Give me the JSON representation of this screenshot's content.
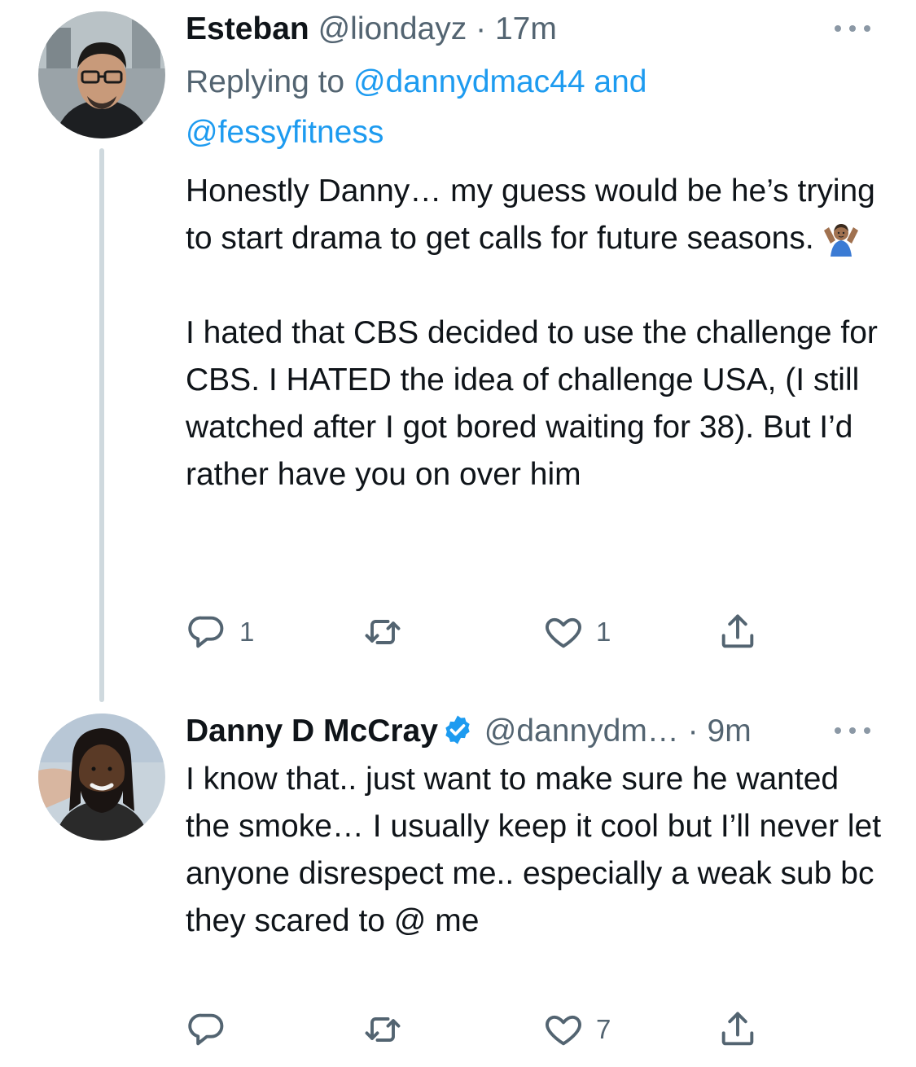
{
  "tweets": [
    {
      "author": {
        "name": "Esteban",
        "handle": "@liondayz",
        "time": "17m",
        "avatar": "avatar-man-glasses",
        "verified": false
      },
      "replying": {
        "prefix": "Replying to",
        "mention1": "@dannydmac44",
        "joiner": "and",
        "mention2": "@fessyfitness"
      },
      "text_part1": "Honestly Danny… my guess would be he’s trying to start drama to get calls for future seasons.",
      "emoji": "person-shrugging-emoji",
      "text_part2": "\n\nI hated that CBS decided to use the challenge for CBS. I HATED the idea of challenge USA, (I still watched after I got bored waiting for 38). But I’d rather have you on over him",
      "actions": {
        "reply_count": "1",
        "retweet_count": "",
        "like_count": "1"
      }
    },
    {
      "author": {
        "name": "Danny D McCray",
        "handle": "@dannydm…",
        "time": "9m",
        "avatar": "avatar-man-beard",
        "verified": true
      },
      "text": "I know that.. just want to make sure he wanted the smoke… I usually keep it cool but I’ll never let anyone disrespect me.. especially a weak sub bc they scared to @ me",
      "actions": {
        "reply_count": "",
        "retweet_count": "",
        "like_count": "7"
      }
    }
  ],
  "separator": "·",
  "icons": {
    "reply": "reply-icon",
    "retweet": "retweet-icon",
    "like": "heart-icon",
    "share": "share-icon",
    "more": "more-icon",
    "verified": "verified-badge-icon"
  },
  "colors": {
    "text": "#0f1419",
    "secondary": "#536471",
    "link": "#1d9bf0",
    "thread_line": "#cfd9de",
    "verified": "#1d9bf0"
  }
}
